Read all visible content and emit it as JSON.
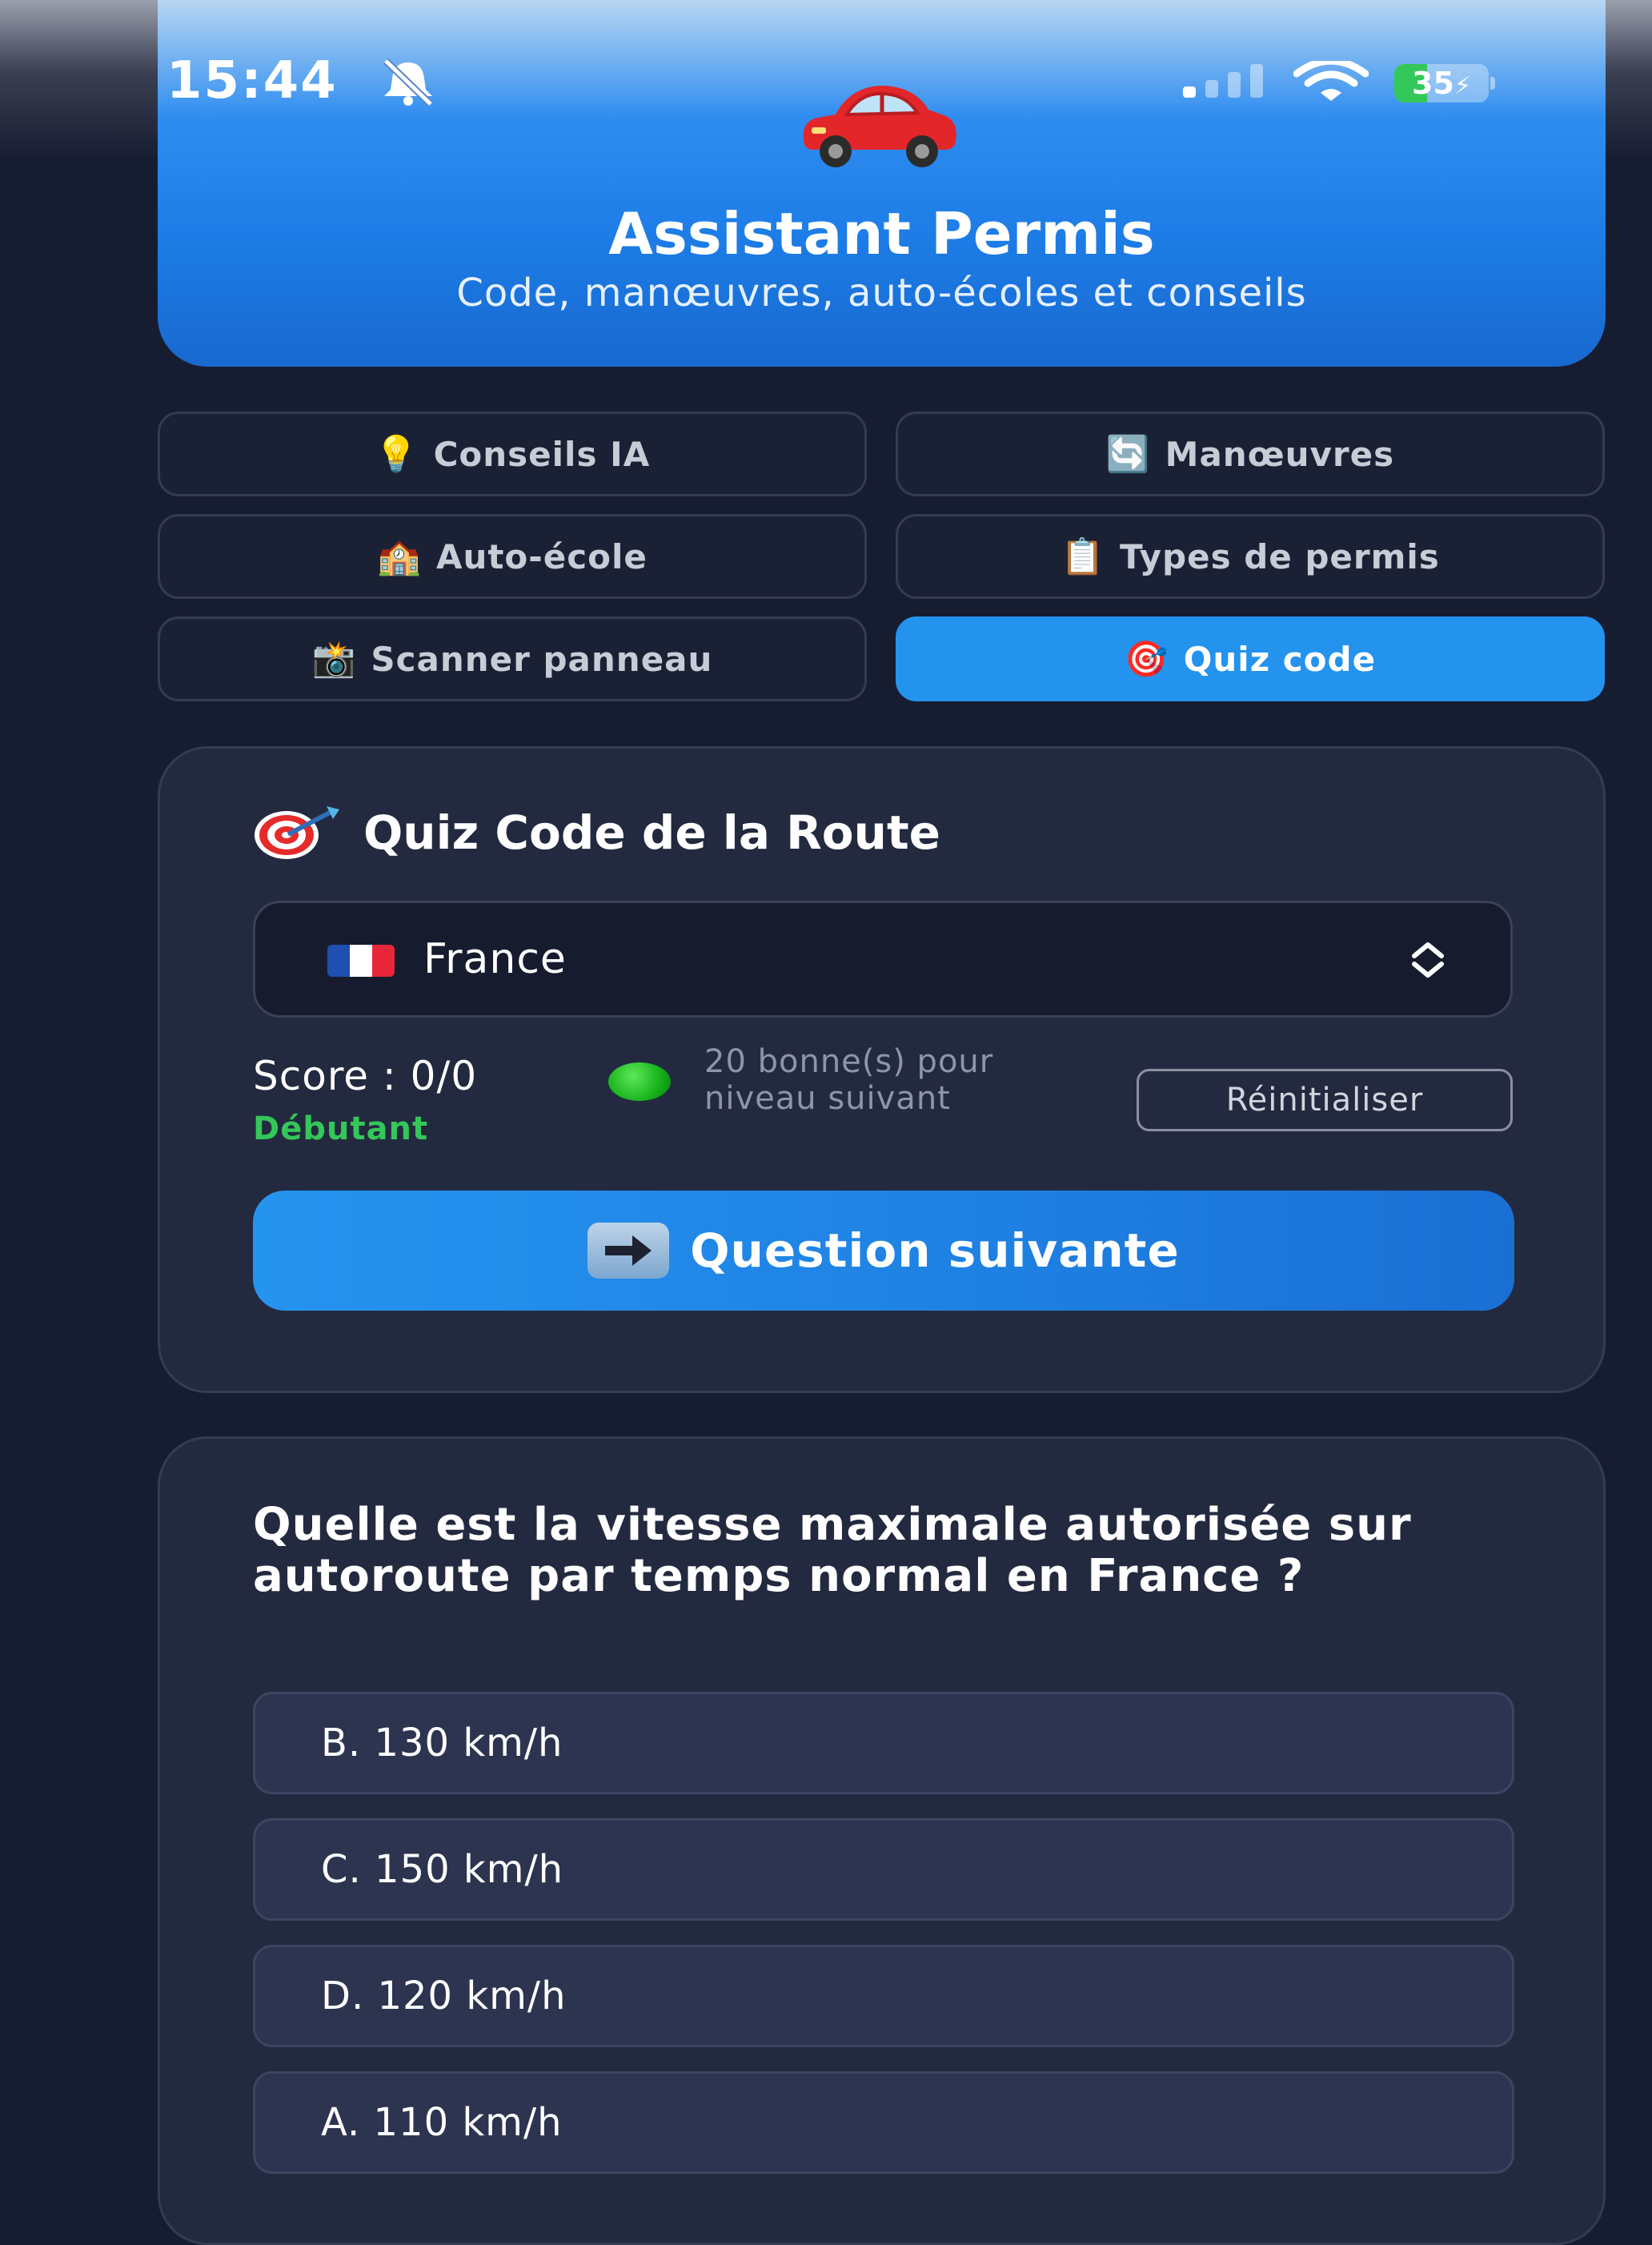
{
  "status_bar": {
    "time": "15:44",
    "battery_level": "35",
    "battery_fraction": 0.35,
    "icons": [
      "bell-slash-icon",
      "cellular-signal-icon",
      "wifi-icon",
      "battery-charging-icon"
    ]
  },
  "header": {
    "icon": "car-icon",
    "title": "Assistant Permis",
    "subtitle": "Code, manœuvres, auto-écoles et conseils"
  },
  "nav": {
    "items": [
      {
        "emoji": "💡",
        "label": "Conseils IA",
        "active": false
      },
      {
        "emoji": "🔄",
        "label": "Manœuvres",
        "active": false
      },
      {
        "emoji": "🏫",
        "label": "Auto-école",
        "active": false
      },
      {
        "emoji": "📋",
        "label": "Types de permis",
        "active": false
      },
      {
        "emoji": "📸",
        "label": "Scanner panneau",
        "active": false
      },
      {
        "emoji": "🎯",
        "label": "Quiz code",
        "active": true
      }
    ]
  },
  "quiz": {
    "title": "Quiz Code de la Route",
    "country": {
      "flag": "french-flag-icon",
      "label": "France"
    },
    "score_label": "Score : 0/0",
    "level_label": "Débutant",
    "progress_note": "20 bonne(s) pour niveau suivant",
    "reset_label": "Réinitialiser",
    "next_label": "Question suivante"
  },
  "question": {
    "text": "Quelle est la vitesse maximale autorisée sur autoroute par temps normal en France ?",
    "answers": [
      "B. 130 km/h",
      "C. 150 km/h",
      "D. 120 km/h",
      "A. 110 km/h"
    ]
  },
  "colors": {
    "background": "#171d31",
    "card": "#232a3f",
    "accent": "#2493ee",
    "level_green": "#34c759"
  }
}
